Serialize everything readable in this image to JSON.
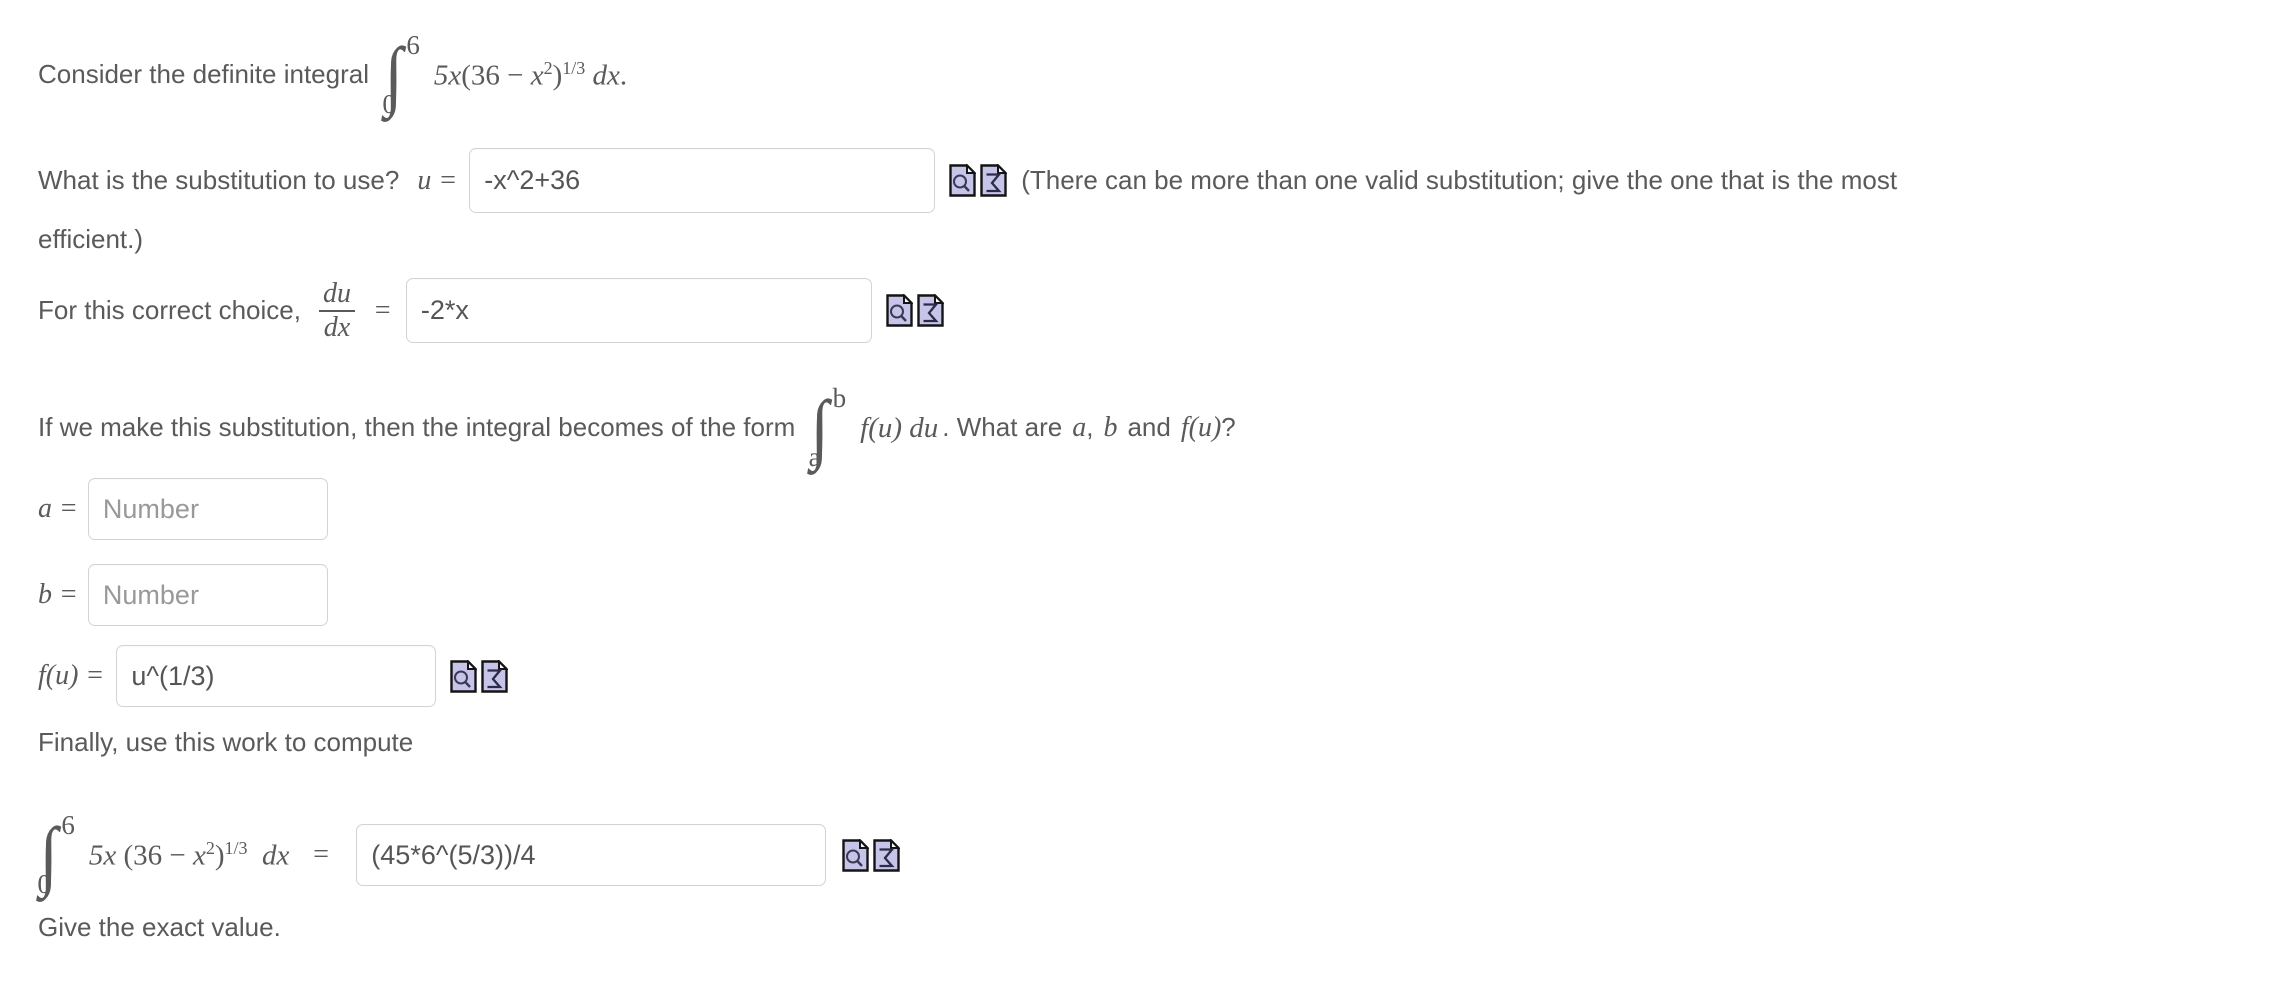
{
  "problem": {
    "intro_text": "Consider the definite integral",
    "integral_1": {
      "lower_limit": "0",
      "upper_limit": "6",
      "integrand": "5x(36 − x²)^(1/3)",
      "integrand_coeff": "5x",
      "integrand_base": "(36 − x",
      "integrand_inner_exp": "2",
      "integrand_close": ")",
      "integrand_power": "1/3",
      "differential": "dx",
      "trailing_period": "."
    },
    "substitution_question": "What is the substitution to use?",
    "u_label": "u =",
    "u_value": "-x^2+36",
    "substitution_note_part1": "(There can be more than one valid substitution; give the one that is the most",
    "substitution_note_part2": "efficient.)",
    "derivative_prompt": "For this correct choice,",
    "derivative_numerator": "du",
    "derivative_denominator": "dx",
    "derivative_equals": "=",
    "dudx_value": "-2*x",
    "form_text_part1": "If we make this substitution, then the integral becomes of the form",
    "form_integral": {
      "lower_limit": "a",
      "upper_limit": "b",
      "integrand": "f(u)",
      "differential": "du"
    },
    "form_text_part2": ".  What are",
    "form_var_a": "a",
    "form_comma": ",",
    "form_var_b": "b",
    "form_and": "and",
    "form_var_fu": "f(u)",
    "form_question_mark": "?",
    "a_label": "a =",
    "a_value": "",
    "a_placeholder": "Number",
    "b_label": "b =",
    "b_value": "",
    "b_placeholder": "Number",
    "fu_label": "f(u) =",
    "fu_value": "u^(1/3)",
    "finally_text": "Finally, use this work to compute",
    "final_integral": {
      "lower_limit": "0",
      "upper_limit": "6",
      "integrand_coeff": "5x",
      "integrand_base": "(36 − x",
      "integrand_inner_exp": "2",
      "integrand_close": ")",
      "integrand_power": "1/3",
      "differential": "dx",
      "equals": "="
    },
    "final_answer_value": "(45*6^(5/3))/4",
    "exact_value_note": "Give the exact value."
  },
  "icons": {
    "preview_icon_name": "preview-magnifier-icon",
    "sigma_icon_name": "sigma-formula-icon",
    "icon_fill": "#c7c4ea",
    "icon_border": "#141414",
    "icon_shade": "#b0ade0"
  },
  "colors": {
    "text": "#5a5a5a",
    "input_text": "#555555",
    "placeholder": "#999999",
    "field_border": "#d3d3d3",
    "background": "#ffffff"
  }
}
